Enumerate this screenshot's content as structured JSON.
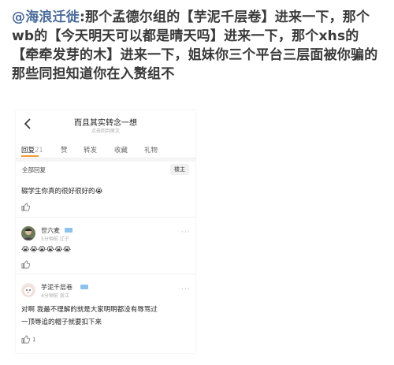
{
  "post": {
    "author": "@海浪迁徙",
    "body": ":那个孟德尔组的【芋泥千层卷】进来一下，那个wb的【今天明天可以都是晴天吗】进来一下，那个xhs的【牵牵发芽的木】进来一下，姐妹你三个平台三层面被你骗的那些同担知道你在入赘组不"
  },
  "screen": {
    "title": "而且其实转念一想",
    "subtitle": "点击回到原文",
    "tabs": [
      {
        "label": "回复",
        "count": "21"
      },
      {
        "label": "赞"
      },
      {
        "label": "转发"
      },
      {
        "label": "收藏"
      },
      {
        "label": "礼物"
      }
    ],
    "filter_label": "全部回复",
    "owner_button": "楼主"
  },
  "comments": [
    {
      "text": "辍学生你真的很好很好的😭"
    },
    {
      "user": "世六麦",
      "meta": "5分钟前 辽宁",
      "emoji": "😭😭😭😭😭😭",
      "emoji_count": 6
    },
    {
      "user": "芋泥千层卷",
      "meta": "4分钟前 浙江",
      "lines": [
        "对啊 我最不理解的就是大家明明都没有辱骂过",
        "一顶辱追的帽子就要扣下来"
      ],
      "likes": "1"
    }
  ]
}
